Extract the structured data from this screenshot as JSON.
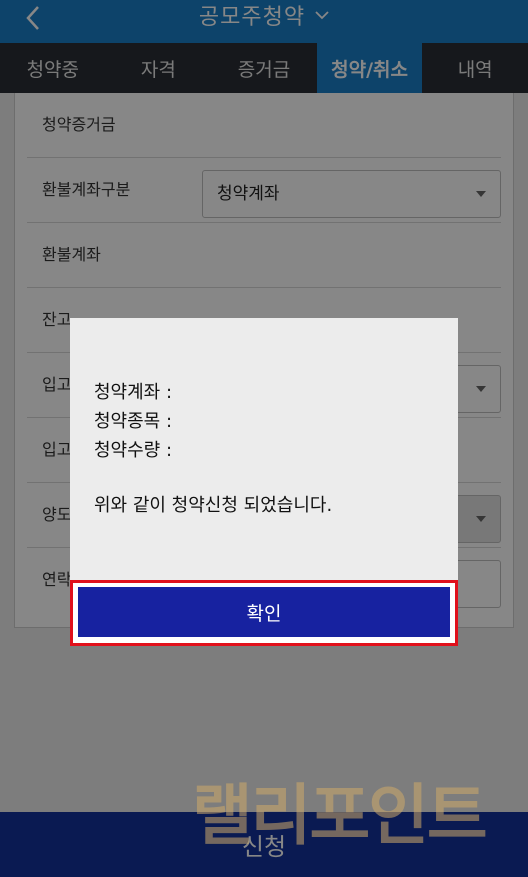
{
  "header": {
    "title": "공모주청약",
    "back_icon": "chevron-left-icon",
    "dropdown_icon": "chevron-down-icon",
    "bg_color": "#1a7fc9"
  },
  "tabs": [
    {
      "label": "청약중",
      "active": false
    },
    {
      "label": "자격",
      "active": false
    },
    {
      "label": "증거금",
      "active": false
    },
    {
      "label": "청약/취소",
      "active": true
    },
    {
      "label": "내역",
      "active": false
    }
  ],
  "form": {
    "deposit_label": "청약증거금",
    "refund_type_label": "환불계좌구분",
    "refund_type_value": "청약계좌",
    "refund_account_label": "환불계좌",
    "balance_label": "잔고",
    "deposit_in_label": "입고",
    "deposit_in2_label": "입고",
    "transfer_label": "양도",
    "contact_label": "연락"
  },
  "bottom": {
    "apply_label": "신청",
    "bg_color": "#14329b"
  },
  "dialog": {
    "account_label": "청약계좌 :",
    "item_label": "청약종목 :",
    "qty_label": "청약수량 :",
    "message": "위와 같이 청약신청 되었습니다.",
    "confirm_label": "확인",
    "confirm_color": "#1722a0",
    "highlight_color": "#e0101b"
  },
  "watermark": {
    "text": "랠리포인트"
  }
}
